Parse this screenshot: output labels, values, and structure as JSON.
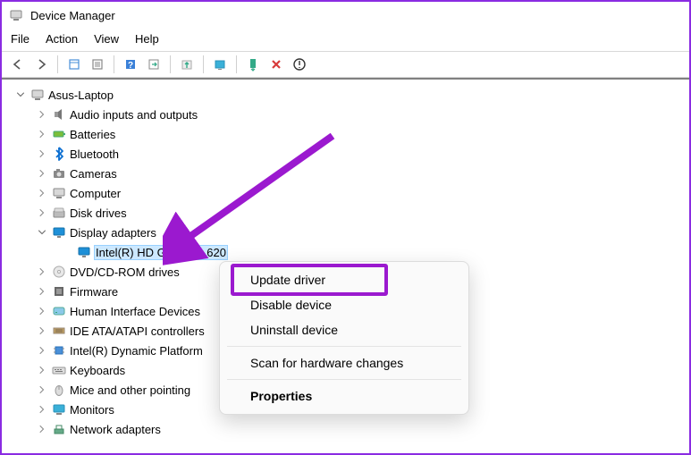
{
  "window": {
    "title": "Device Manager"
  },
  "menu": {
    "file": "File",
    "action": "Action",
    "view": "View",
    "help": "Help"
  },
  "toolbar_icons": [
    "back-icon",
    "forward-icon",
    "sep",
    "show-hidden-icon",
    "properties-icon",
    "sep",
    "help-icon",
    "action-icon",
    "sep",
    "update-driver-icon",
    "sep",
    "scan-icon",
    "sep",
    "enable-icon",
    "disable-icon",
    "uninstall-icon"
  ],
  "tree": {
    "root": {
      "label": "Asus-Laptop",
      "icon": "computer"
    },
    "children": [
      {
        "label": "Audio inputs and outputs",
        "icon": "audio"
      },
      {
        "label": "Batteries",
        "icon": "battery"
      },
      {
        "label": "Bluetooth",
        "icon": "bluetooth"
      },
      {
        "label": "Cameras",
        "icon": "camera"
      },
      {
        "label": "Computer",
        "icon": "computer"
      },
      {
        "label": "Disk drives",
        "icon": "disk"
      },
      {
        "label": "Display adapters",
        "icon": "display",
        "expanded": true,
        "children": [
          {
            "label": "Intel(R) HD Graphics 620",
            "icon": "display",
            "selected": true
          }
        ]
      },
      {
        "label": "DVD/CD-ROM drives",
        "icon": "cd"
      },
      {
        "label": "Firmware",
        "icon": "firmware"
      },
      {
        "label": "Human Interface Devices",
        "icon": "hid"
      },
      {
        "label": "IDE ATA/ATAPI controllers",
        "icon": "ide"
      },
      {
        "label": "Intel(R) Dynamic Platform",
        "icon": "chip"
      },
      {
        "label": "Keyboards",
        "icon": "keyboard"
      },
      {
        "label": "Mice and other pointing",
        "icon": "mouse"
      },
      {
        "label": "Monitors",
        "icon": "monitor"
      },
      {
        "label": "Network adapters",
        "icon": "network"
      }
    ]
  },
  "context_menu": {
    "update": "Update driver",
    "disable": "Disable device",
    "uninstall": "Uninstall device",
    "scan": "Scan for hardware changes",
    "properties": "Properties"
  }
}
